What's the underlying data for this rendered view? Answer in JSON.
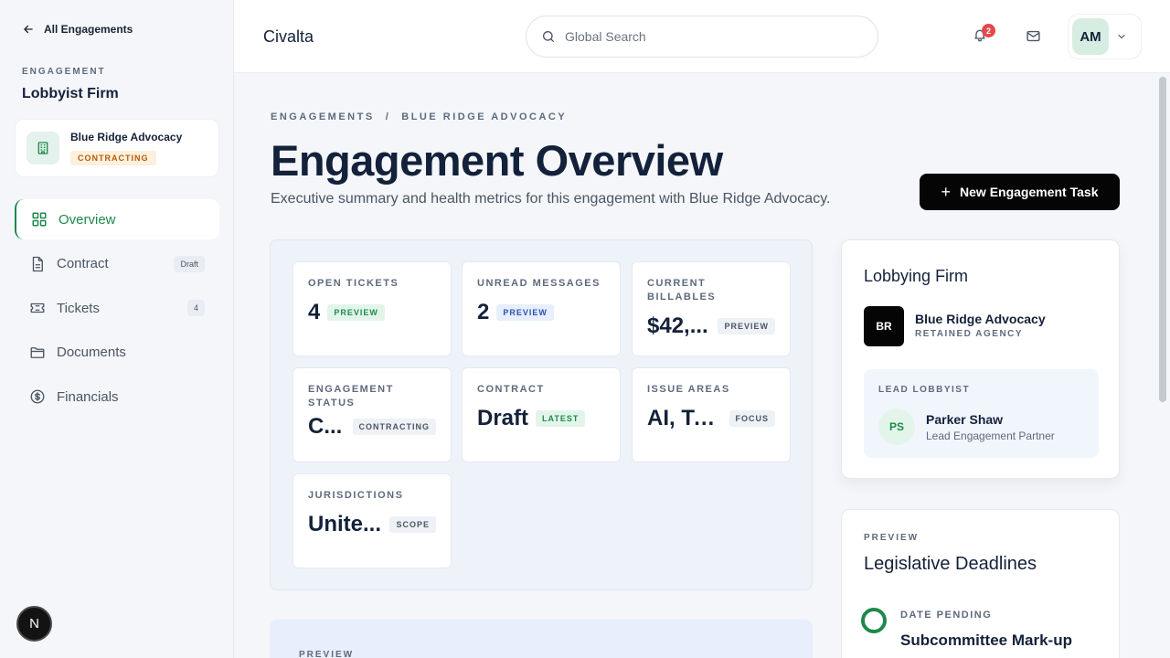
{
  "sidebar": {
    "back_label": "All Engagements",
    "section_label": "ENGAGEMENT",
    "firm_type": "Lobbyist Firm",
    "client": {
      "name": "Blue Ridge Advocacy",
      "status": "CONTRACTING"
    },
    "nav": [
      {
        "label": "Overview",
        "icon": "grid-icon",
        "badge": ""
      },
      {
        "label": "Contract",
        "icon": "document-icon",
        "badge": "Draft"
      },
      {
        "label": "Tickets",
        "icon": "ticket-icon",
        "badge": "4"
      },
      {
        "label": "Documents",
        "icon": "folder-icon",
        "badge": ""
      },
      {
        "label": "Financials",
        "icon": "dollar-icon",
        "badge": ""
      }
    ],
    "bubble_letter": "N"
  },
  "header": {
    "brand": "Civalta",
    "search_placeholder": "Global Search",
    "notification_count": "2",
    "avatar_initials": "AM"
  },
  "main": {
    "breadcrumb": [
      "ENGAGEMENTS",
      "/",
      "BLUE RIDGE ADVOCACY"
    ],
    "title": "Engagement Overview",
    "subtitle": "Executive summary and health metrics for this engagement with Blue Ridge Advocacy.",
    "new_task_label": "New Engagement Task",
    "metrics": [
      {
        "label": "OPEN TICKETS",
        "value": "4",
        "tag": "PREVIEW",
        "tag_color": "green"
      },
      {
        "label": "UNREAD MESSAGES",
        "value": "2",
        "tag": "PREVIEW",
        "tag_color": "blue"
      },
      {
        "label": "CURRENT BILLABLES",
        "value": "$42,...",
        "tag": "PREVIEW",
        "tag_color": "gray"
      },
      {
        "label": "ENGAGEMENT STATUS",
        "value": "C...",
        "tag": "CONTRACTING",
        "tag_color": "gray"
      },
      {
        "label": "CONTRACT",
        "value": "Draft",
        "tag": "LATEST",
        "tag_color": "green"
      },
      {
        "label": "ISSUE AREAS",
        "value": "AI, Te...",
        "tag": "FOCUS",
        "tag_color": "gray"
      },
      {
        "label": "JURISDICTIONS",
        "value": "Unite...",
        "tag": "SCOPE",
        "tag_color": "gray"
      }
    ],
    "preview_label": "PREVIEW"
  },
  "firm_card": {
    "title": "Lobbying Firm",
    "logo": "BR",
    "name": "Blue Ridge Advocacy",
    "type": "RETAINED AGENCY",
    "lead_label": "LEAD LOBBYIST",
    "lead_initials": "PS",
    "lead_name": "Parker Shaw",
    "lead_role": "Lead Engagement Partner"
  },
  "deadlines": {
    "preview": "PREVIEW",
    "title": "Legislative Deadlines",
    "status": "DATE PENDING",
    "item": "Subcommittee Mark-up"
  },
  "colors": {
    "accent_green": "#1d8a4a",
    "primary_button": "#050505",
    "notification_red": "#e5484d",
    "status_orange": "#b45c09"
  }
}
